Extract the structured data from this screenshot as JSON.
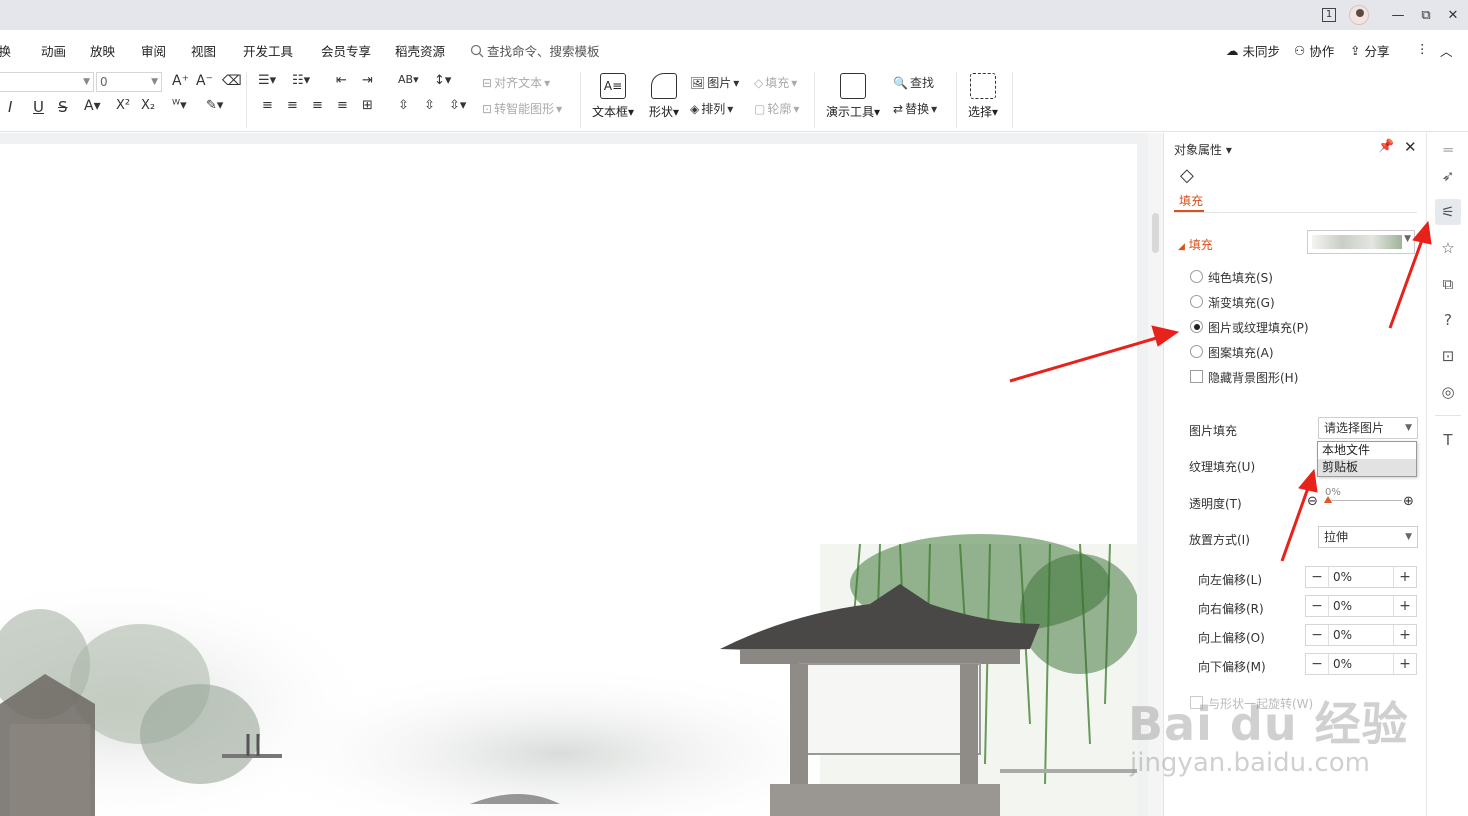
{
  "title_bar": {
    "page_indicator": "1",
    "restore": "⧉",
    "minimize": "—",
    "close": "✕"
  },
  "menu": {
    "items": [
      "切换",
      "动画",
      "放映",
      "审阅",
      "视图",
      "开发工具",
      "会员专享",
      "稻壳资源"
    ],
    "search": "查找命令、搜索模板",
    "sync": "未同步",
    "collab": "协作",
    "share": "分享"
  },
  "ribbon": {
    "font_size_value": "0",
    "align_text": "对齐文本",
    "smart_shape": "转智能图形",
    "textbox": "文本框",
    "shape": "形状",
    "picture": "图片",
    "arrange": "排列",
    "fill": "填充",
    "outline": "轮廓",
    "present_tool": "演示工具",
    "find": "查找",
    "replace": "替换",
    "select": "选择"
  },
  "panel": {
    "title": "对象属性",
    "tab_fill": "填充",
    "section_fill": "填充",
    "options": [
      {
        "label": "纯色填充(S)",
        "selected": false
      },
      {
        "label": "渐变填充(G)",
        "selected": false
      },
      {
        "label": "图片或纹理填充(P)",
        "selected": true
      },
      {
        "label": "图案填充(A)",
        "selected": false
      }
    ],
    "hide_bg": "隐藏背景图形(H)",
    "picture_fill_label": "图片填充",
    "picture_fill_value": "请选择图片",
    "dropdown_options": [
      "本地文件",
      "剪贴板"
    ],
    "texture_fill_label": "纹理填充(U)",
    "transparency_label": "透明度(T)",
    "transparency_value": "0%",
    "placement_label": "放置方式(I)",
    "placement_value": "拉伸",
    "offsets": [
      {
        "label": "向左偏移(L)",
        "value": "0%"
      },
      {
        "label": "向右偏移(R)",
        "value": "0%"
      },
      {
        "label": "向上偏移(O)",
        "value": "0%"
      },
      {
        "label": "向下偏移(M)",
        "value": "0%"
      }
    ],
    "rotate_with_shape": "与形状一起旋转(W)"
  },
  "watermark": {
    "main": "Bai du 经验",
    "sub": "jingyan.baidu.com"
  },
  "colors": {
    "accent": "#d9511c",
    "arrow": "#e8211a"
  }
}
